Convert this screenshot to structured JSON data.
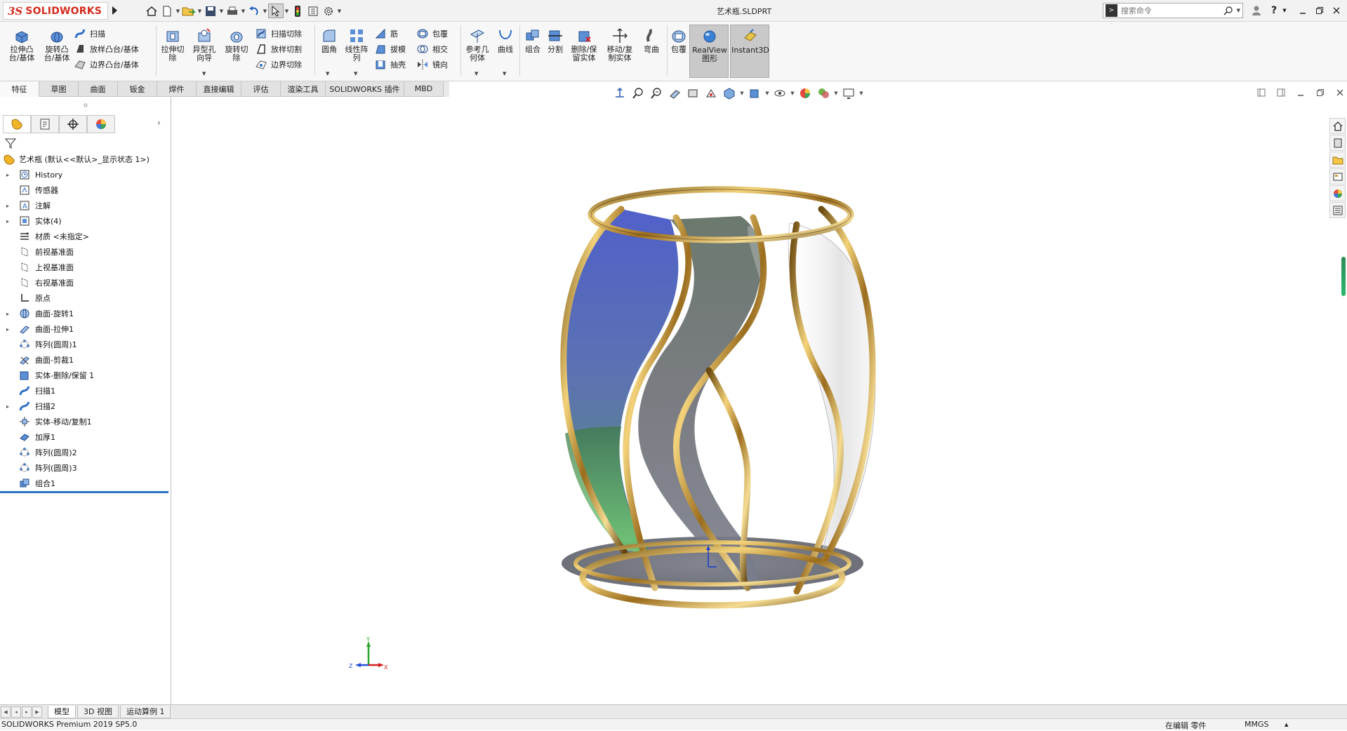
{
  "app": {
    "logo_text": "SOLIDWORKS",
    "document_title": "艺术瓶.SLDPRT",
    "search_placeholder": "搜索命令"
  },
  "quick_access": [
    "home-icon",
    "new-document-icon",
    "open-icon",
    "save-icon",
    "print-icon",
    "undo-icon",
    "select-icon",
    "rebuild-icon",
    "file-properties-icon",
    "options-icon"
  ],
  "ribbon": {
    "big_buttons": {
      "extrude_boss": "拉伸凸\n台/基体",
      "revolve_boss": "旋转凸\n台/基体",
      "extrude_cut": "拉伸切\n除",
      "hole_wizard": "异型孔\n向导",
      "revolve_cut": "旋转切\n除",
      "fillet": "圆角",
      "linear_pattern": "线性阵\n列",
      "ref_geometry": "参考几\n何体",
      "curves": "曲线",
      "combine": "组合",
      "split": "分割",
      "delete_keep_body": "删除/保\n留实体",
      "move_copy_body": "移动/复\n制实体",
      "flex": "弯曲",
      "wrap": "包覆",
      "realview": "RealView\n图形",
      "instant3d": "Instant3D"
    },
    "small_buttons": {
      "sweep": "扫描",
      "loft_boss": "放样凸台/基体",
      "boundary_boss": "边界凸台/基体",
      "swept_cut": "扫描切除",
      "lofted_cut": "放样切割",
      "boundary_cut": "边界切除",
      "rib": "筋",
      "draft": "拔模",
      "shell": "抽壳",
      "wrap": "包覆",
      "intersect": "相交",
      "mirror": "镜向"
    }
  },
  "command_tabs": [
    "特征",
    "草图",
    "曲面",
    "钣金",
    "焊件",
    "直接编辑",
    "评估",
    "渲染工具",
    "SOLIDWORKS 插件",
    "MBD"
  ],
  "active_command_tab": "特征",
  "feature_tree": {
    "root": "艺术瓶  (默认<<默认>_显示状态 1>)",
    "items": [
      {
        "label": "History",
        "icon": "history-icon",
        "expandable": true
      },
      {
        "label": "传感器",
        "icon": "sensor-icon",
        "expandable": false
      },
      {
        "label": "注解",
        "icon": "annotation-icon",
        "expandable": true
      },
      {
        "label": "实体(4)",
        "icon": "solid-bodies-icon",
        "expandable": true
      },
      {
        "label": "材质 <未指定>",
        "icon": "material-icon",
        "expandable": false
      },
      {
        "label": "前视基准面",
        "icon": "plane-icon",
        "expandable": false
      },
      {
        "label": "上视基准面",
        "icon": "plane-icon",
        "expandable": false
      },
      {
        "label": "右视基准面",
        "icon": "plane-icon",
        "expandable": false
      },
      {
        "label": "原点",
        "icon": "origin-icon",
        "expandable": false
      },
      {
        "label": "曲面-旋转1",
        "icon": "revolve-surface-icon",
        "expandable": true
      },
      {
        "label": "曲面-拉伸1",
        "icon": "extrude-surface-icon",
        "expandable": true
      },
      {
        "label": "阵列(圆周)1",
        "icon": "circular-pattern-icon",
        "expandable": false
      },
      {
        "label": "曲面-剪裁1",
        "icon": "trim-surface-icon",
        "expandable": false
      },
      {
        "label": "实体-删除/保留 1",
        "icon": "delete-body-icon",
        "expandable": false
      },
      {
        "label": "扫描1",
        "icon": "sweep-icon",
        "expandable": false
      },
      {
        "label": "扫描2",
        "icon": "sweep-icon",
        "expandable": true
      },
      {
        "label": "实体-移动/复制1",
        "icon": "move-copy-icon",
        "expandable": false
      },
      {
        "label": "加厚1",
        "icon": "thicken-icon",
        "expandable": false
      },
      {
        "label": "阵列(圆周)2",
        "icon": "circular-pattern-icon",
        "expandable": false
      },
      {
        "label": "阵列(圆周)3",
        "icon": "circular-pattern-icon",
        "expandable": false
      },
      {
        "label": "组合1",
        "icon": "combine-icon",
        "expandable": false
      }
    ]
  },
  "triad": {
    "x_label": "X",
    "y_label": "Y",
    "z_label": "Z"
  },
  "bottom_tabs": [
    "模型",
    "3D 视图",
    "运动算例 1"
  ],
  "active_bottom_tab": "模型",
  "status": {
    "product": "SOLIDWORKS Premium 2019 SP5.0",
    "mode": "在编辑 零件",
    "units": "MMGS"
  },
  "colors": {
    "brand_red": "#d52b1e",
    "gold_frame": "#c79a2e",
    "glass_blue": "#4050b8",
    "glass_green": "#5cc46a",
    "glass_gray": "#6d7078",
    "selection_blue": "#2b72c6"
  }
}
